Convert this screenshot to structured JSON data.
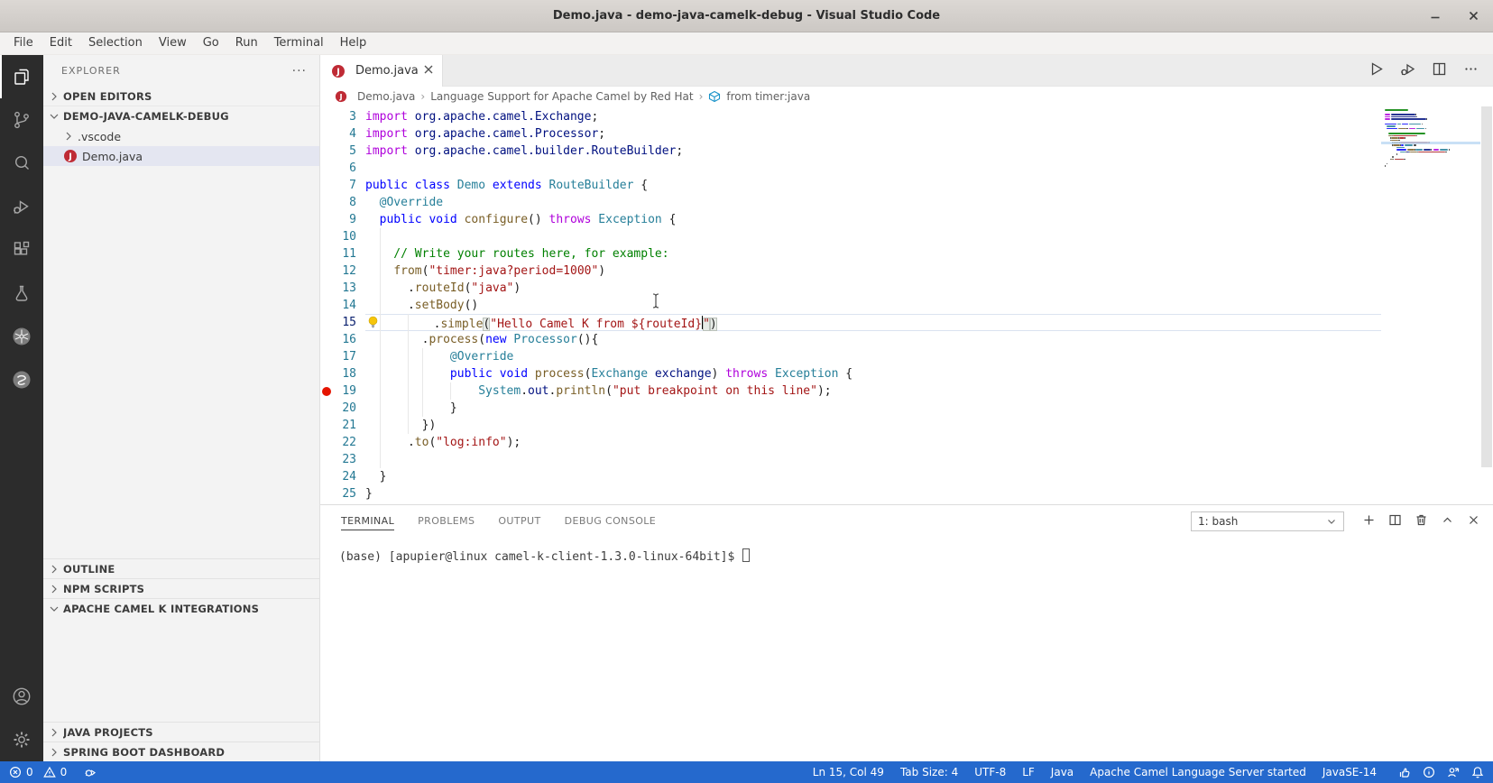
{
  "window": {
    "title": "Demo.java - demo-java-camelk-debug - Visual Studio Code"
  },
  "menu": {
    "items": [
      "File",
      "Edit",
      "Selection",
      "View",
      "Go",
      "Run",
      "Terminal",
      "Help"
    ]
  },
  "activity_bar": {
    "icons": [
      "explorer",
      "source-control",
      "search",
      "run-and-debug",
      "extensions",
      "testing",
      "kubernetes",
      "spring"
    ],
    "bottom_icons": [
      "account",
      "settings"
    ]
  },
  "sidebar": {
    "header": "EXPLORER",
    "rows": {
      "open_editors": "OPEN EDITORS",
      "root_folder": "DEMO-JAVA-CAMELK-DEBUG",
      "vscode_folder": ".vscode",
      "demo_file": "Demo.java",
      "outline": "OUTLINE",
      "npm_scripts": "NPM SCRIPTS",
      "camel_k": "APACHE CAMEL K INTEGRATIONS",
      "java_projects": "JAVA PROJECTS",
      "spring_boot": "SPRING BOOT DASHBOARD"
    }
  },
  "editor": {
    "tab": {
      "label": "Demo.java"
    },
    "breadcrumb": [
      "Demo.java",
      "Language Support for Apache Camel by Red Hat",
      "from timer:java"
    ],
    "cursor_line": 15,
    "breakpoint_line": 19,
    "lightbulb_line": 15,
    "minimap_prefix": [
      {
        "tokens": [
          [
            "com",
            "// camel-k: language=java"
          ]
        ]
      },
      {
        "tokens": []
      }
    ],
    "code_lines": [
      {
        "n": 3,
        "tokens": [
          [
            "kw",
            "import"
          ],
          [
            "pkg",
            " org.apache.camel.Exchange"
          ],
          [
            "pl",
            ";"
          ]
        ]
      },
      {
        "n": 4,
        "tokens": [
          [
            "kw",
            "import"
          ],
          [
            "pkg",
            " org.apache.camel.Processor"
          ],
          [
            "pl",
            ";"
          ]
        ]
      },
      {
        "n": 5,
        "tokens": [
          [
            "kw",
            "import"
          ],
          [
            "pkg",
            " org.apache.camel.builder.RouteBuilder"
          ],
          [
            "pl",
            ";"
          ]
        ]
      },
      {
        "n": 6,
        "tokens": [],
        "guides": []
      },
      {
        "n": 7,
        "tokens": [
          [
            "st",
            "public class "
          ],
          [
            "ty",
            "Demo"
          ],
          [
            "st",
            " extends "
          ],
          [
            "ty",
            "RouteBuilder"
          ],
          [
            "pl",
            " {"
          ]
        ]
      },
      {
        "n": 8,
        "tokens": [
          [
            "pl",
            "  "
          ],
          [
            "ty",
            "@Override"
          ]
        ]
      },
      {
        "n": 9,
        "tokens": [
          [
            "pl",
            "  "
          ],
          [
            "st",
            "public void "
          ],
          [
            "fn",
            "configure"
          ],
          [
            "pl",
            "() "
          ],
          [
            "kw",
            "throws"
          ],
          [
            "ty",
            " Exception"
          ],
          [
            "pl",
            " {"
          ]
        ]
      },
      {
        "n": 10,
        "tokens": [],
        "guides": [
          2
        ]
      },
      {
        "n": 11,
        "tokens": [
          [
            "com",
            "    // Write your routes here, for example:"
          ]
        ]
      },
      {
        "n": 12,
        "tokens": [
          [
            "pl",
            "    "
          ],
          [
            "fn",
            "from"
          ],
          [
            "pl",
            "("
          ],
          [
            "str",
            "\"timer:java?period=1000\""
          ],
          [
            "pl",
            ")"
          ]
        ]
      },
      {
        "n": 13,
        "tokens": [
          [
            "pl",
            "      ."
          ],
          [
            "fn",
            "routeId"
          ],
          [
            "pl",
            "("
          ],
          [
            "str",
            "\"java\""
          ],
          [
            "pl",
            ")"
          ]
        ]
      },
      {
        "n": 14,
        "tokens": [
          [
            "pl",
            "      ."
          ],
          [
            "fn",
            "setBody"
          ],
          [
            "pl",
            "()"
          ]
        ]
      },
      {
        "n": 15,
        "tokens": [
          [
            "pl",
            "        ."
          ],
          [
            "fn",
            "simple"
          ],
          [
            "pl-hl",
            "("
          ],
          [
            "str",
            "\"Hello Camel K from ${routeId}"
          ],
          [
            "cursor",
            ""
          ],
          [
            "str-hl",
            "\""
          ],
          [
            "pl-hl",
            ")"
          ]
        ]
      },
      {
        "n": 16,
        "tokens": [
          [
            "pl",
            "        ."
          ],
          [
            "fn",
            "process"
          ],
          [
            "pl",
            "("
          ],
          [
            "st",
            "new"
          ],
          [
            "ty",
            " Processor"
          ],
          [
            "pl",
            "(){"
          ]
        ]
      },
      {
        "n": 17,
        "tokens": [
          [
            "pl",
            "            "
          ],
          [
            "ty",
            "@Override"
          ]
        ]
      },
      {
        "n": 18,
        "tokens": [
          [
            "pl",
            "            "
          ],
          [
            "st",
            "public void "
          ],
          [
            "fn",
            "process"
          ],
          [
            "pl",
            "("
          ],
          [
            "ty",
            "Exchange"
          ],
          [
            "var",
            " exchange"
          ],
          [
            "pl",
            ") "
          ],
          [
            "kw",
            "throws"
          ],
          [
            "ty",
            " Exception"
          ],
          [
            "pl",
            " {"
          ]
        ]
      },
      {
        "n": 19,
        "tokens": [
          [
            "pl",
            "                "
          ],
          [
            "ty",
            "System"
          ],
          [
            "pl",
            "."
          ],
          [
            "var",
            "out"
          ],
          [
            "pl",
            "."
          ],
          [
            "fn",
            "println"
          ],
          [
            "pl",
            "("
          ],
          [
            "str",
            "\"put breakpoint on this line\""
          ],
          [
            "pl",
            ");"
          ]
        ]
      },
      {
        "n": 20,
        "tokens": [
          [
            "pl",
            "            }"
          ]
        ]
      },
      {
        "n": 21,
        "tokens": [
          [
            "pl",
            "        })"
          ]
        ]
      },
      {
        "n": 22,
        "tokens": [
          [
            "pl",
            "      ."
          ],
          [
            "fn",
            "to"
          ],
          [
            "pl",
            "("
          ],
          [
            "str",
            "\"log:info\""
          ],
          [
            "pl",
            ");"
          ]
        ]
      },
      {
        "n": 23,
        "tokens": [],
        "guides": [
          2
        ]
      },
      {
        "n": 24,
        "tokens": [
          [
            "pl",
            "  }"
          ]
        ]
      },
      {
        "n": 25,
        "tokens": [
          [
            "pl",
            "}"
          ]
        ]
      }
    ]
  },
  "panel": {
    "tabs": [
      "TERMINAL",
      "PROBLEMS",
      "OUTPUT",
      "DEBUG CONSOLE"
    ],
    "active_tab": "TERMINAL",
    "shell_select": "1: bash",
    "terminal_prompt": "(base) [apupier@linux camel-k-client-1.3.0-linux-64bit]$ "
  },
  "status_bar": {
    "errors": "0",
    "warnings": "0",
    "right_items": [
      "Ln 15, Col 49",
      "Tab Size: 4",
      "UTF-8",
      "LF",
      "Java",
      "Apache Camel Language Server started",
      "JavaSE-14"
    ]
  },
  "colors": {
    "kw": "#AF00DB",
    "st": "#0000FF",
    "ty": "#267F99",
    "fn": "#795E26",
    "str": "#A31515",
    "str-hl": "#A31515",
    "com": "#008000",
    "pkg": "#001080",
    "var": "#001080",
    "pl": "#1e1e1e",
    "pl-hl": "#1e1e1e",
    "status_bar": "#2569cd",
    "breakpoint": "#e51400",
    "lightbulb": "#f6c50a",
    "java_file_icon": "#bf2b35",
    "camel_icon": "#1a93c9"
  }
}
